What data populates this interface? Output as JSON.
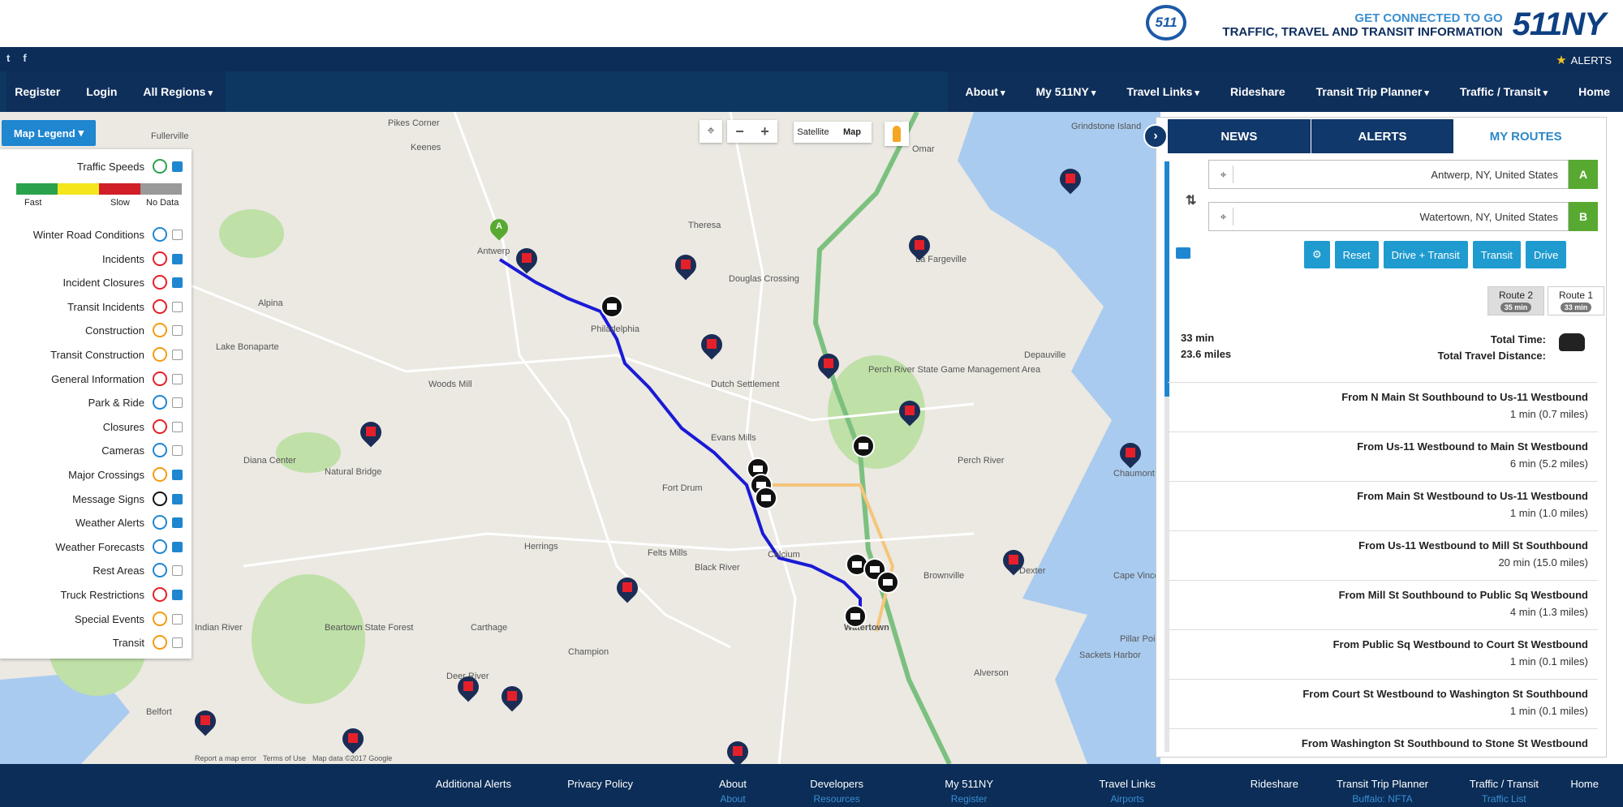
{
  "header": {
    "tagline_line1": "GET CONNECTED TO GO",
    "tagline_line2": "TRAFFIC, TRAVEL AND TRANSIT INFORMATION",
    "brand": "511NY",
    "seal": "511"
  },
  "alert_bar": {
    "label": "ALERTS",
    "social": [
      "t",
      "f"
    ]
  },
  "nav": {
    "right": [
      "Home",
      "Traffic / Transit",
      "Transit Trip Planner",
      "Rideshare",
      "Travel Links",
      "My 511NY",
      "About"
    ],
    "left": [
      "Register",
      "Login",
      "All Regions"
    ]
  },
  "map": {
    "legend_button": "Map Legend",
    "map_type": [
      "Map",
      "Satellite"
    ],
    "zoom": [
      "+",
      "−"
    ],
    "locate": "⌖",
    "speed_labels": [
      "Fast",
      "Slow",
      "No Data"
    ],
    "speed_colors": [
      "#2aa24d",
      "#f3e61d",
      "#d01f26",
      "#999999"
    ],
    "legend_items": [
      {
        "label": "Traffic Speeds",
        "checked": true,
        "icon": "traffic-speeds-icon",
        "color": "#2aa24d"
      },
      {
        "label": "Winter Road Conditions",
        "checked": false,
        "icon": "snowflake-icon",
        "color": "#1f86d0"
      },
      {
        "label": "Incidents",
        "checked": true,
        "icon": "incident-icon",
        "color": "#e5202a"
      },
      {
        "label": "Incident Closures",
        "checked": true,
        "icon": "closure-icon",
        "color": "#e5202a"
      },
      {
        "label": "Transit Incidents",
        "checked": false,
        "icon": "transit-incident-icon",
        "color": "#e5202a"
      },
      {
        "label": "Construction",
        "checked": false,
        "icon": "construction-icon",
        "color": "#f39c12"
      },
      {
        "label": "Transit Construction",
        "checked": false,
        "icon": "transit-construction-icon",
        "color": "#f39c12"
      },
      {
        "label": "General Information",
        "checked": false,
        "icon": "info-icon",
        "color": "#e5202a"
      },
      {
        "label": "Park & Ride",
        "checked": false,
        "icon": "park-ride-icon",
        "color": "#1f86d0"
      },
      {
        "label": "Closures",
        "checked": false,
        "icon": "closures-icon",
        "color": "#e5202a"
      },
      {
        "label": "Cameras",
        "checked": false,
        "icon": "camera-icon",
        "color": "#1f86d0"
      },
      {
        "label": "Major Crossings",
        "checked": true,
        "icon": "crossing-icon",
        "color": "#f39c12"
      },
      {
        "label": "Message Signs",
        "checked": true,
        "icon": "message-sign-icon",
        "color": "#111111"
      },
      {
        "label": "Weather Alerts",
        "checked": true,
        "icon": "weather-alert-icon",
        "color": "#1f86d0"
      },
      {
        "label": "Weather Forecasts",
        "checked": true,
        "icon": "weather-forecast-icon",
        "color": "#1f86d0"
      },
      {
        "label": "Rest Areas",
        "checked": false,
        "icon": "rest-area-icon",
        "color": "#1f86d0"
      },
      {
        "label": "Truck Restrictions",
        "checked": true,
        "icon": "truck-icon",
        "color": "#e5202a"
      },
      {
        "label": "Special Events",
        "checked": false,
        "icon": "special-event-icon",
        "color": "#f39c12"
      },
      {
        "label": "Transit",
        "checked": false,
        "icon": "transit-icon",
        "color": "#f39c12"
      }
    ],
    "places": [
      "Fullerville",
      "Pikes Corner",
      "Keenes",
      "Antwerp",
      "Theresa",
      "Omar",
      "Grindstone Island",
      "La Fargeville",
      "Alpina",
      "Lake Bonaparte",
      "Philadelphia",
      "Douglas Crossing",
      "Woods Mill",
      "Dutch Settlement",
      "Perch River State Game Management Area",
      "Depauville",
      "Evans Mills",
      "Natural Bridge",
      "Diana Center",
      "Fort Drum",
      "Perch River",
      "Chaumont",
      "Herrings",
      "Felts Mills",
      "Black River",
      "Calcium",
      "Brownville",
      "Dexter",
      "Carthage",
      "Beartown State Forest",
      "Champion",
      "Watertown",
      "Pillar Point",
      "Sackets Harbor",
      "Alverson",
      "Deer River",
      "Belfort",
      "Indian River",
      "Cape Vincent"
    ],
    "footer": [
      "Map data ©2017 Google",
      "Terms of Use",
      "Report a map error"
    ]
  },
  "panel": {
    "tabs": [
      "MY ROUTES",
      "ALERTS",
      "NEWS"
    ],
    "origin": {
      "letter": "A",
      "value": "Antwerp, NY, United States"
    },
    "destination": {
      "letter": "B",
      "value": "Watertown, NY, United States"
    },
    "buttons": [
      "Drive",
      "Transit",
      "Drive + Transit",
      "Reset",
      "⚙"
    ],
    "route_tabs": [
      {
        "label": "Route 1",
        "time": "33 min"
      },
      {
        "label": "Route 2",
        "time": "35 min"
      }
    ],
    "summary": {
      "time_label": "Total Time:",
      "time_value": "33 min",
      "distance_label": "Total Travel Distance:",
      "distance_value": "23.6 miles"
    },
    "steps": [
      {
        "title": "From N Main St Southbound to Us-11 Westbound",
        "detail": "1 min (0.7 miles)"
      },
      {
        "title": "From Us-11 Westbound to Main St Westbound",
        "detail": "6 min (5.2 miles)"
      },
      {
        "title": "From Main St Westbound to Us-11 Westbound",
        "detail": "1 min (1.0 miles)"
      },
      {
        "title": "From Us-11 Westbound to Mill St Southbound",
        "detail": "20 min (15.0 miles)"
      },
      {
        "title": "From Mill St Southbound to Public Sq Westbound",
        "detail": "4 min (1.3 miles)"
      },
      {
        "title": "From Public Sq Westbound to Court St Westbound",
        "detail": "1 min (0.1 miles)"
      },
      {
        "title": "From Court St Westbound to Washington St Southbound",
        "detail": "1 min (0.1 miles)"
      },
      {
        "title": "From Washington St Southbound to Stone St Westbound",
        "detail": ""
      }
    ]
  },
  "footer": {
    "columns": [
      {
        "label": "Home",
        "sub": ""
      },
      {
        "label": "Traffic / Transit",
        "sub": "Traffic List"
      },
      {
        "label": "Transit Trip Planner",
        "sub": "Buffalo: NFTA"
      },
      {
        "label": "Rideshare",
        "sub": ""
      },
      {
        "label": "Travel Links",
        "sub": "Airports"
      },
      {
        "label": "My 511NY",
        "sub": "Register"
      },
      {
        "label": "Developers",
        "sub": "Resources"
      },
      {
        "label": "About",
        "sub": "About"
      },
      {
        "label": "Privacy Policy",
        "sub": ""
      },
      {
        "label": "Additional Alerts",
        "sub": ""
      }
    ]
  }
}
